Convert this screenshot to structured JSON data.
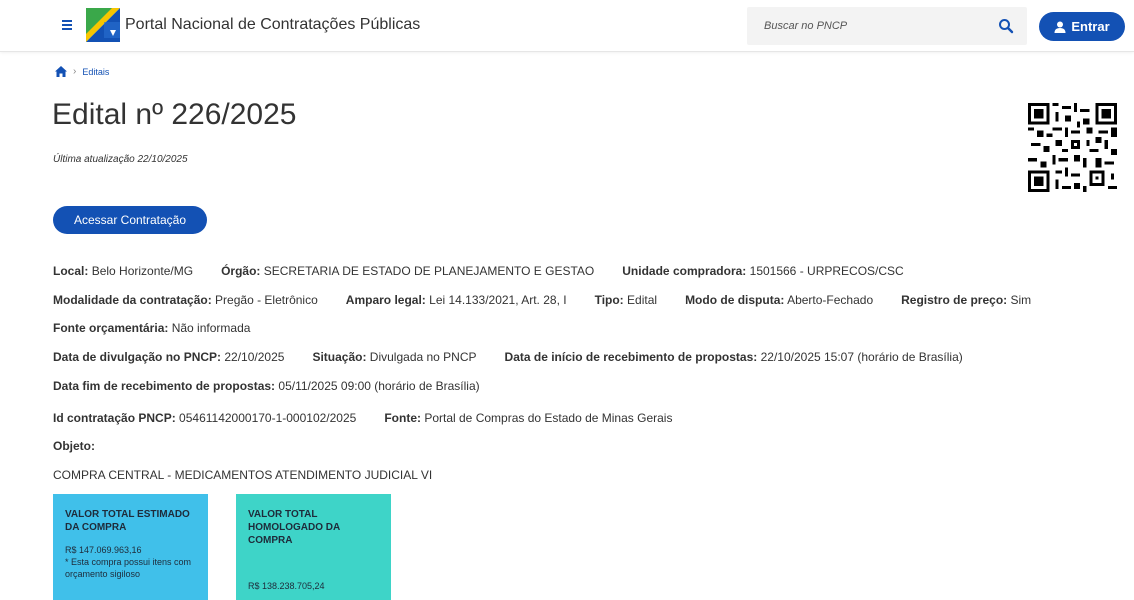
{
  "header": {
    "portal_title": "Portal Nacional de Contratações Públicas",
    "search_placeholder": "Buscar no PNCP",
    "login_label": "Entrar",
    "accent": "#1351b4"
  },
  "breadcrumb": {
    "home_icon": "home-icon",
    "current": "Editais"
  },
  "page": {
    "title": "Edital nº 226/2025",
    "updated": "Última atualização 22/10/2025",
    "access_button": "Acessar Contratação"
  },
  "info": {
    "local_label": "Local:",
    "local_value": "Belo Horizonte/MG",
    "orgao_label": "Órgão:",
    "orgao_value": "SECRETARIA DE ESTADO DE PLANEJAMENTO E GESTAO",
    "unidade_label": "Unidade compradora:",
    "unidade_value": "1501566 - URPRECOS/CSC",
    "modalidade_label": "Modalidade da contratação:",
    "modalidade_value": "Pregão - Eletrônico",
    "amparo_label": "Amparo legal:",
    "amparo_value": "Lei 14.133/2021, Art. 28, I",
    "tipo_label": "Tipo:",
    "tipo_value": "Edital",
    "disputa_label": "Modo de disputa:",
    "disputa_value": "Aberto-Fechado",
    "registro_label": "Registro de preço:",
    "registro_value": "Sim",
    "fonte_orc_label": "Fonte orçamentária:",
    "fonte_orc_value": "Não informada",
    "divulgacao_label": "Data de divulgação no PNCP:",
    "divulgacao_value": "22/10/2025",
    "situacao_label": "Situação:",
    "situacao_value": "Divulgada no PNCP",
    "inicio_label": "Data de início de recebimento de propostas:",
    "inicio_value": "22/10/2025 15:07 (horário de Brasília)",
    "fim_label": "Data fim de recebimento de propostas:",
    "fim_value": "05/11/2025 09:00 (horário de Brasília)",
    "id_label": "Id contratação PNCP:",
    "id_value": "05461142000170-1-000102/2025",
    "fonte_label": "Fonte:",
    "fonte_value": "Portal de Compras do Estado de Minas Gerais",
    "objeto_label": "Objeto:",
    "objeto_value": "COMPRA CENTRAL - MEDICAMENTOS ATENDIMENTO JUDICIAL VI"
  },
  "cards": {
    "estimado_title": "VALOR TOTAL ESTIMADO DA COMPRA",
    "estimado_value": "R$ 147.069.963,16",
    "estimado_note": "* Esta compra possui itens com orçamento sigiloso",
    "homologado_title": "VALOR TOTAL HOMOLOGADO DA COMPRA",
    "homologado_value": "R$ 138.238.705,24",
    "estimado_color": "#40c0ea",
    "homologado_color": "#3ed4c8"
  }
}
